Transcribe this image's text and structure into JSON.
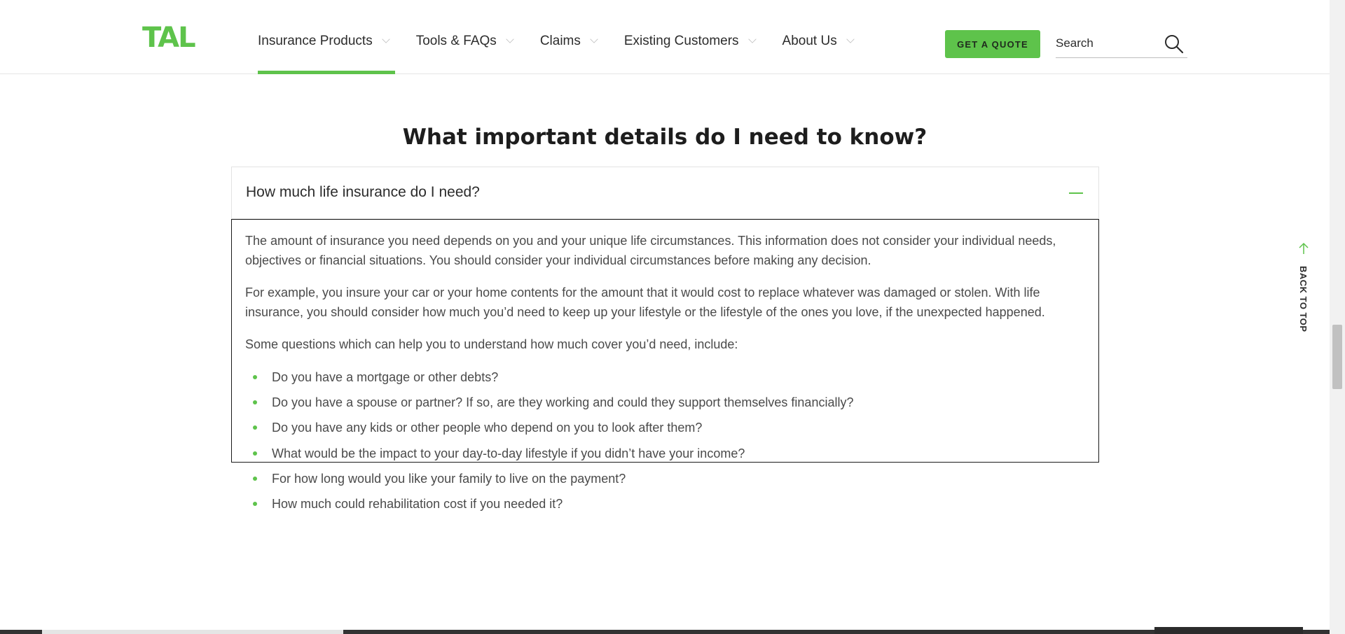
{
  "header": {
    "logo": "TAL",
    "nav": [
      {
        "label": "Insurance Products",
        "active": true
      },
      {
        "label": "Tools & FAQs",
        "active": false
      },
      {
        "label": "Claims",
        "active": false
      },
      {
        "label": "Existing Customers",
        "active": false
      },
      {
        "label": "About Us",
        "active": false
      }
    ],
    "quote_button": "GET A QUOTE",
    "search_placeholder": "Search",
    "accent_color": "#5ec34b"
  },
  "main": {
    "title": "What important details do I need to know?",
    "accordion": {
      "question": "How much life insurance do I need?",
      "expanded": true,
      "paragraphs": [
        "The amount of insurance you need depends on you and your unique life circumstances.  This information does not consider your individual needs, objectives or financial situations.  You should consider your individual circumstances before making any decision.",
        "For example, you insure your car or your home contents for the amount that it would cost to replace whatever was damaged or stolen. With life insurance, you should consider how much you’d need to keep up your lifestyle or the lifestyle of the ones you love, if the unexpected happened.",
        "Some questions which can help you to understand how much cover you’d need, include:"
      ],
      "list": [
        "Do you have a mortgage or other debts?",
        "Do you have a spouse or partner? If so, are they working and could they support themselves financially?",
        "Do you have any kids or other people who depend on you to look after them?",
        "What would be the impact to your day-to-day lifestyle if you didn’t have your income?",
        "For how long would you like your family to live on the payment?",
        "How much could rehabilitation cost if you needed it?"
      ]
    }
  },
  "back_to_top": "BACK TO TOP"
}
